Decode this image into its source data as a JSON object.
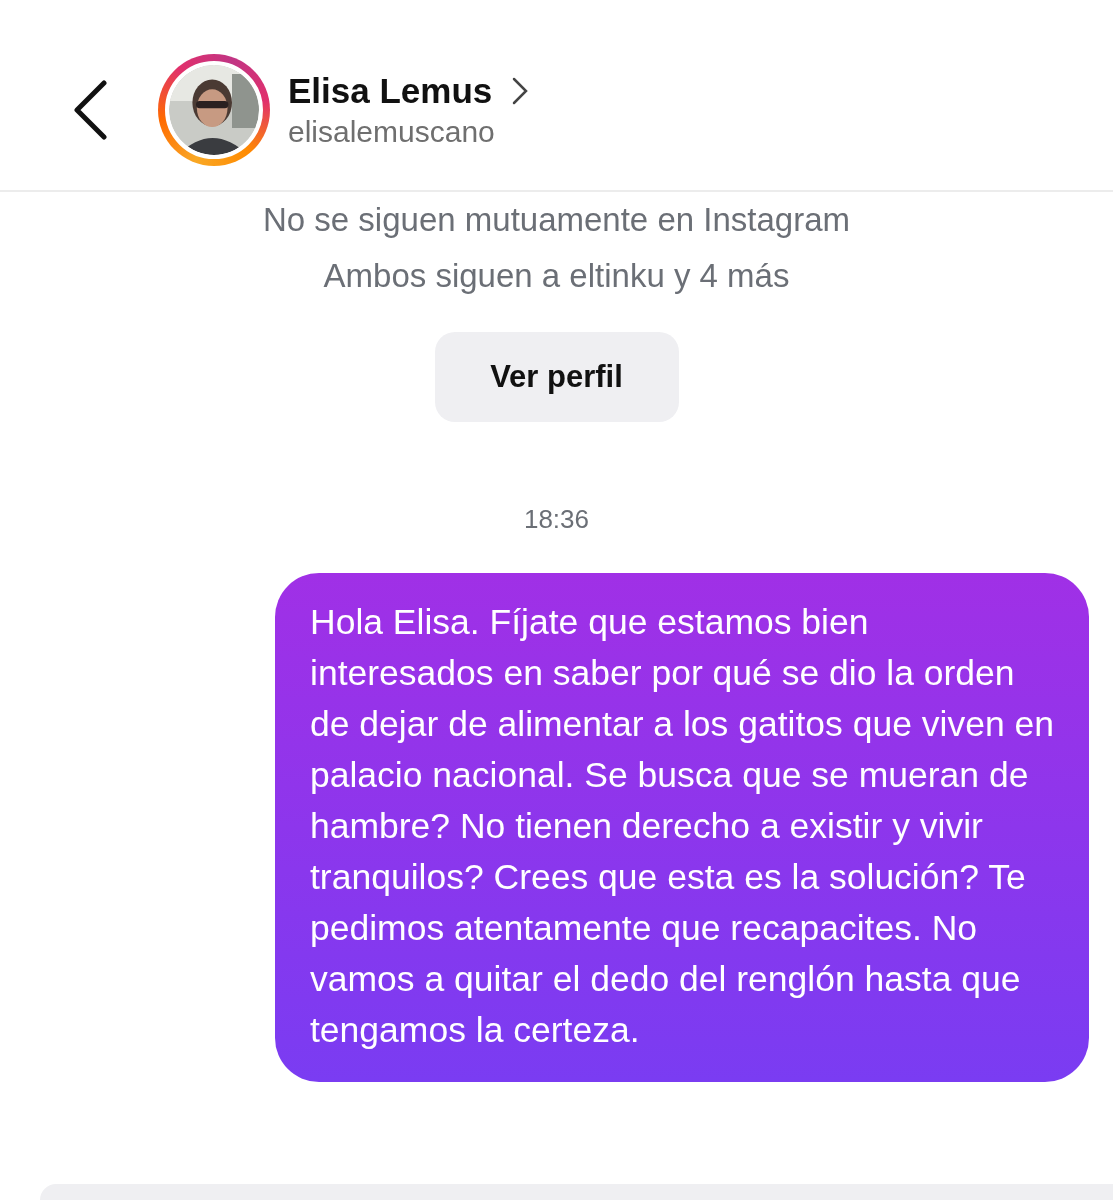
{
  "header": {
    "name": "Elisa Lemus",
    "username": "elisalemuscano"
  },
  "profile_info": {
    "mutual": "No se siguen mutuamente en Instagram",
    "followers": "Ambos siguen a eltinku y 4 más",
    "button": "Ver perfil"
  },
  "timestamp": "18:36",
  "messages": [
    {
      "kind": "sent",
      "text": "Hola Elisa. Fíjate que estamos bien interesados en saber por qué se dio la orden de dejar de alimentar a los gatitos que viven en palacio nacional. Se busca que se mueran de hambre? No tienen derecho a existir y vivir tranquilos? Crees que esta es la solución? Te pedimos atentamente que recapacites. No vamos a quitar el dedo del renglón hasta que tengamos la certeza."
    }
  ]
}
